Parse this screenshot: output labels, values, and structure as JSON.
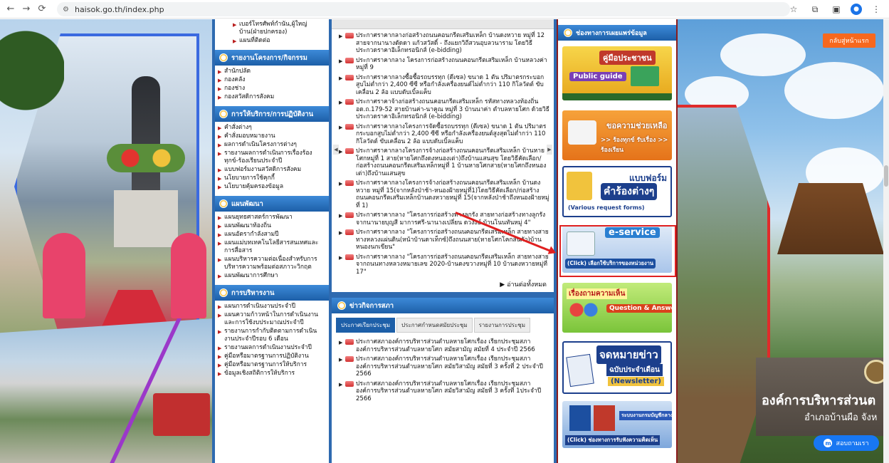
{
  "browser": {
    "url": "haisok.go.th/index.php",
    "back_icon": "arrow-left",
    "forward_icon": "arrow-right",
    "reload_icon": "reload"
  },
  "left_menu": {
    "top_items": [
      "เบอร์โทรศัพท์กำนัน,ผู้ใหญ่บ้าน(ฝ่ายปกครอง)",
      "แผนที่ติดต่อ"
    ],
    "sections": [
      {
        "title": "รายงานโครงการ/กิจกรรม",
        "items": [
          "สำนักปลัด",
          "กองคลัง",
          "กองช่าง",
          "กองสวัสดิการสังคม"
        ]
      },
      {
        "title": "การให้บริการ/การปฏิบัติงาน",
        "items": [
          "คำสั่งต่างๆ",
          "คำสั่งมอบหมายงาน",
          "ผลการดำเนินโครงการต่างๆ",
          "รายงานผลการดำเนินการเรื่องร้องทุกข์-ร้องเรียนประจำปี",
          "แบบฟอร์มงานสวัสดิการสังคม",
          "นโยบายการใช้คุกกี้",
          "นโยบายคุ้มครองข้อมูล"
        ]
      },
      {
        "title": "แผนพัฒนา",
        "items": [
          "แผนยุทธศาสตร์การพัฒนา",
          "แผนพัฒนาท้องถิ่น",
          "แผนอัตรากำลังสามปี",
          "แผนแม่บทเทคโนโลยีสารสนเทศและการสื่อสาร",
          "แผนบริหารความต่อเนื่องสำหรับการบริหารความพร้อมต่อสภาวะวิกฤต",
          "แผนพัฒนาการศึกษา"
        ]
      },
      {
        "title": "การบริหารงาน",
        "items": [
          "แผนการดำเนินงานประจำปี",
          "แผนความก้าวหน้าในการดำเนินงานและการใช้งบประมาณประจำปี",
          "รายงานการกำกับติดตามการดำเนินงานประจำปีรอบ 6 เดือน",
          "รายงานผลการดำเนินงานประจำปี",
          "คู่มือหรือมาตรฐานการปฏิบัติงาน",
          "คู่มือหรือมาตรฐานการให้บริการ",
          "ข้อมูลเชิงสถิติการให้บริการ"
        ]
      }
    ]
  },
  "news": {
    "items": [
      "ประกาศราคากลางก่อสร้างถนนคอนกรีตเสริมเหล็ก บ้านดงหวาย หมู่ที่ 12 สายจากนานางดัดดา แก้วสวัสดิ์ - ถึงแยกวิถีสวนอุบลวนาราม โดยวิธีประกวดราคาอิเล็กทรอนิกส์ (e-bidding)",
      "ประกาศราคากลาง โครงการก่อสร้างถนนคอนกรีตเสริมเหล็ก บ้านหลวงค่า หมู่ที่ 9",
      "ประกาศราคากลางซื้อซื้อรถบรรทุก (ดีเซล) ขนาด 1 ตัน ปริมาตรกระบอกสูบไม่ต่ำกว่า 2,400 ซีซี หรือกำลังเครื่องยนต์ไม่ต่ำกว่า 110 กิโลวัตต์ ขับเคลื่อน 2 ล้อ แบบดับเบิ้ลแค็บ",
      "ประกาศราคาจ้างก่อสร้างถนนคอนกรีตเสริมเหล็ก รหัสทางหลวงท้องถิ่น อด.ถ.179-52 สายบ้านค่า-นาคูณ หมู่ที่ 3 บ้านนาค่า ตำบลหายโศก ด้วยวิธีประกวดราคาอิเล็กทรอนิกส์ (e-bidding)",
      "ประกาศราคากลางโครงการจัดซื้อรถบรรทุก (ดีเซล) ขนาด 1 ตัน ปริมาตรกระบอกสูบไม่ต่ำกว่า 2,400 ซีซี หรือกำลังเครื่องยนต์สูงสุดไม่ต่ำกว่า 110 กิโลวัตต์ ขับเคลื่อน 2 ล้อ แบบดับเบิ้ลแค็บ",
      "ประกาศราคากลางโครงการจ้างก่อสร้างถนนคอนกรีตเสริมเหล็ก บ้านหายโศกหมู่ที่ 1 สาย(หายโศกถึงดงหนองเต่า)ถึงบ้านแสนสุข โดยวิธีคัดเลือก/ก่อสร้างถนนคอนกรีตเสริมเหล็กหมู่ที่ 1 บ้านหายโศกสาย(หายโศกถึงหนองเต่า)ถึงบ้านแสนสุข",
      "ประกาศราคากลางโครงการจ้างก่อสร้างถนนคอนกรีตเสริมเหล็ก บ้านดงหวาย หมู่ที่ 15(จากหลังป่าช้า-หนองฝ้ายหมู่ที่1)โดยวิธีคัดเลือก/ก่อสร้างถนนคอนกรีตเสริมเหล็กบ้านดงหวายหมู่ที่ 15(จากหลังป่าช้าถึงหนองฝ้ายหมู่ที่ 1)",
      "ประกาศราคากลาง \"โครงการก่อสร้างทางลูกรัง สายทางก่อสร้างทางลูกรังจากนานายบุญสี มาการศรี-นานางเปลี่ยน ดวงงษ์ บ้านโนนทันหมู่ 4\"",
      "ประกาศราคากลาง \"โครงการก่อสร้างถนนคอนกรีตเสริมเหล็ก สายทางสายทางหลวงแผ่นดิน(หน้าบ้านดาเท็กซ์)ถึงถนนสาย(หายโศกโคกสันกัว)บ้านหนองนกเขียน\"",
      "ประกาศราคากลาง \"โครงการก่อสร้างถนนคอนกรีตเสริมเหล็ก สายทางสายจากถนนทางหลวงหมายเลข 2020-บ้านดงขวางหมู่ที่ 10 บ้านดงหวายหมู่ที่ 17\""
    ],
    "readmore": "อ่านต่อทั้งหมด"
  },
  "council": {
    "title": "ข่าวกิจการสภา",
    "tabs": [
      "ประกาศเรียกประชุม",
      "ประกาศกำหนดสมัยประชุม",
      "รายงานการประชุม"
    ],
    "items": [
      "ประกาศสภาองค์การบริหารส่วนตำบลหายโศกเรื่อง เรียกประชุมสภาองค์การบริหารส่วนตำบลหายโศก สมัยสามัญ สมัยที่ 4 ประจำปี 2566",
      "ประกาศสภาองค์การบริหารส่วนตำบลหายโศกเรื่อง เรียกประชุมสภาองค์การบริหารส่วนตำบลหายโศก สมัยวิสามัญ สมัยที่ 3 ครั้งที่ 2 ประจำปี 2566",
      "ประกาศสภาองค์การบริหารส่วนตำบลหายโศกเรื่อง เรียกประชุมสภาองค์การบริหารส่วนตำบลหายโศก สมัยวิสามัญ สมัยที่ 3 ครั้งที่ 1ประจำปี 2566"
    ]
  },
  "pr_channels": {
    "title": "ช่องทางการเผยแพร่ข้อมูล",
    "banners": [
      {
        "title": "คู่มือประชาชน",
        "sub": "Public guide",
        "bg": "#f2c318"
      },
      {
        "title": "ขอความช่วยเหลือ",
        "sub": ">> ร้องทุกข์ รับเรื่อง >> ร้องเรียน",
        "bg": "#f08a1c"
      },
      {
        "title": "แบบฟอร์ม",
        "sub": "คำร้องต่างๆ",
        "extra": "(Various request forms)",
        "bg": "#2a58b6"
      },
      {
        "title": "e-service",
        "sub": "(Click) เลือกใช้บริการของหน่วยงาน",
        "bg": "#2a7fd1"
      },
      {
        "title": "เรื่องถามความเห็น",
        "sub": "Question & Answer",
        "bg": "#8ad23a"
      },
      {
        "title": "จดหมายข่าว",
        "sub": "ฉบับประจำเดือน",
        "extra": "(Newsletter)",
        "bg": "#ffffff"
      },
      {
        "title": "ระบบงานกรมบัญชีกลาง",
        "sub": "(Click) ช่องทางการรับฟังความคิดเห็น",
        "bg": "#3a76c8"
      }
    ]
  },
  "right_sign": {
    "title": "องค์การบริหารส่วนต",
    "subtitle": "อำเภอบ้านผือ  จังห"
  },
  "buttons": {
    "back_home": "กลับสู่หน้าแรก",
    "messenger": "สอบถามเรา"
  }
}
